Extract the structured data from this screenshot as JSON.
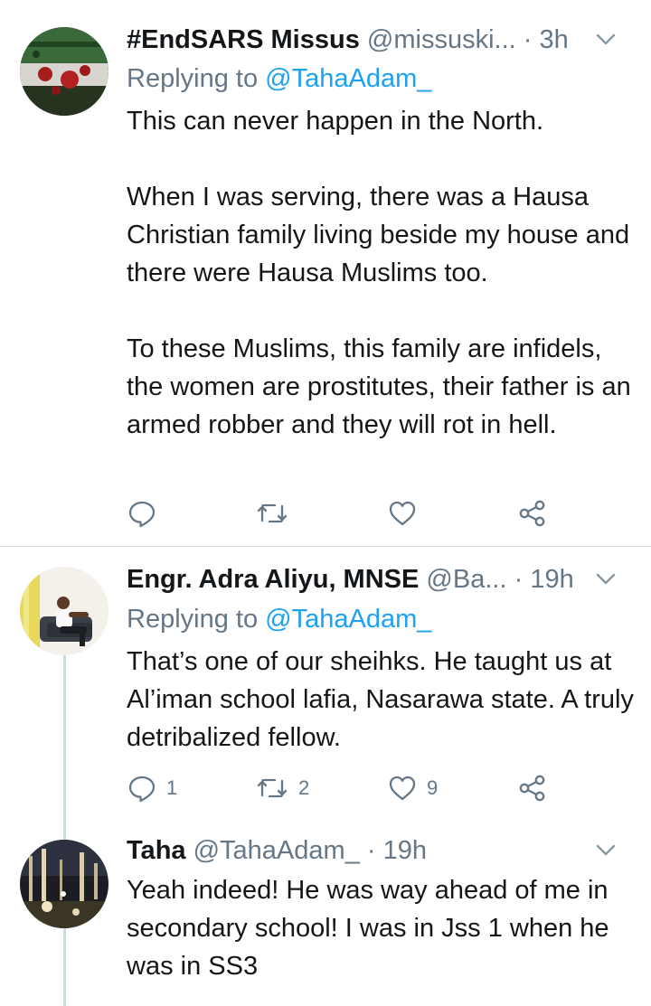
{
  "tweets": [
    {
      "name": "#EndSARS Missus",
      "handle": "@missuski...",
      "dot": "·",
      "time": "3h",
      "replying_prefix": "Replying to",
      "replying_to": "@TahaAdam_",
      "text": "This can never happen in the North.\n\nWhen I was serving, there was a Hausa Christian family living beside my house and there were Hausa Muslims too.\n\nTo these Muslims, this family are infidels, the women are prostitutes, their father is an armed robber and they will rot in hell.",
      "counts": {
        "reply": "",
        "retweet": "",
        "like": ""
      }
    },
    {
      "name": "Engr. Adra Aliyu, MNSE",
      "handle": "@Ba...",
      "dot": "·",
      "time": "19h",
      "replying_prefix": "Replying to",
      "replying_to": "@TahaAdam_",
      "text": "That’s one of our sheihks. He taught us at Al’iman school lafia, Nasarawa state. A truly detribalized fellow.",
      "counts": {
        "reply": "1",
        "retweet": "2",
        "like": "9"
      }
    },
    {
      "name": "Taha",
      "handle": "@TahaAdam_",
      "dot": "·",
      "time": "19h",
      "text": "Yeah indeed! He was way ahead of me in secondary school! I was in Jss 1 when he was in SS3"
    }
  ],
  "icons": {
    "reply": "reply-icon",
    "retweet": "retweet-icon",
    "like": "heart-icon",
    "share": "share-icon",
    "more": "chevron-down-icon"
  },
  "colors": {
    "text": "#14171a",
    "secondary": "#657786",
    "link": "#1da1f2",
    "divider": "#d8dde2"
  }
}
